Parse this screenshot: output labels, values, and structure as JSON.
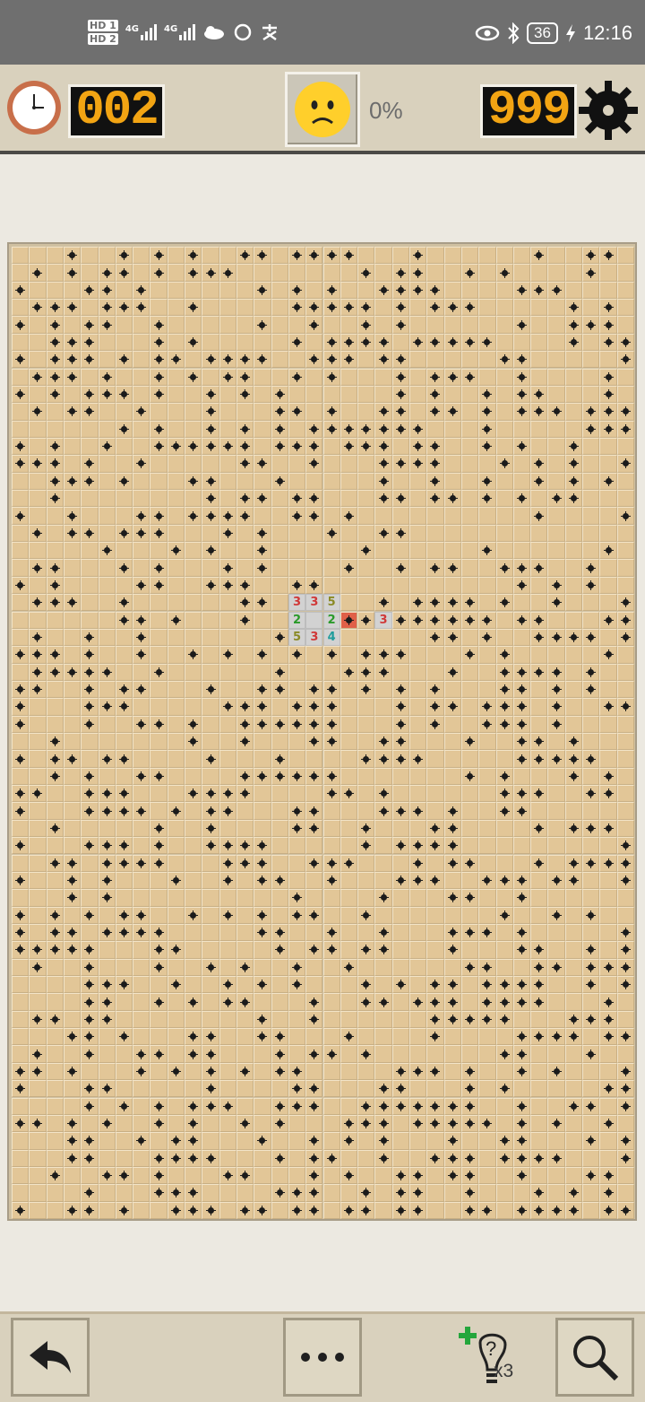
{
  "status_bar": {
    "sim_labels": [
      "HD 1",
      "HD 2"
    ],
    "network_labels": [
      "4G",
      "4G"
    ],
    "battery": "36",
    "time": "12:16"
  },
  "game": {
    "timer": "002",
    "progress": "0%",
    "mines_left": "999",
    "face_state": "sad-face-icon",
    "hints_left": "x3",
    "board_cols": 36,
    "board_rows": 56,
    "revealed_cells": [
      {
        "row": 20,
        "col": 16,
        "value": "3",
        "color": "#d03838"
      },
      {
        "row": 20,
        "col": 17,
        "value": "3",
        "color": "#d03838"
      },
      {
        "row": 20,
        "col": 18,
        "value": "5",
        "color": "#8a8a26"
      },
      {
        "row": 21,
        "col": 16,
        "value": "2",
        "color": "#2a9a2a"
      },
      {
        "row": 21,
        "col": 17,
        "value": "",
        "color": ""
      },
      {
        "row": 21,
        "col": 18,
        "value": "2",
        "color": "#2a9a2a"
      },
      {
        "row": 22,
        "col": 16,
        "value": "5",
        "color": "#8a8a26"
      },
      {
        "row": 22,
        "col": 17,
        "value": "3",
        "color": "#d03838"
      },
      {
        "row": 22,
        "col": 18,
        "value": "4",
        "color": "#1f9c9c"
      },
      {
        "row": 21,
        "col": 21,
        "value": "3",
        "color": "#d03838"
      }
    ],
    "exploded_cell": {
      "row": 21,
      "col": 19
    }
  },
  "colors": {
    "counter_digits": "#f2a413",
    "cell": "#e2c697",
    "exploded": "#e06048",
    "toolbar": "#d9d1bd"
  }
}
